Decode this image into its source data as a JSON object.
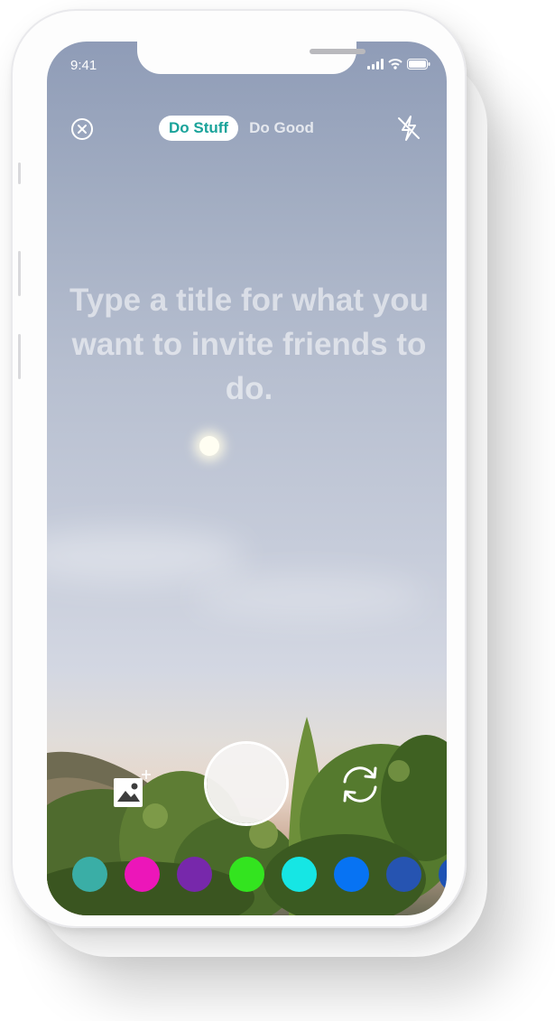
{
  "status_bar": {
    "time": "9:41"
  },
  "header": {
    "close_icon": "close-circle-icon",
    "tabs": [
      {
        "label": "Do Stuff",
        "selected": true
      },
      {
        "label": "Do Good",
        "selected": false
      }
    ],
    "flash_icon": "flash-off-icon"
  },
  "prompt": {
    "text": "Type a title for what you want to invite friends to do."
  },
  "controls": {
    "gallery_icon": "add-photo-icon",
    "shutter": "shutter-button",
    "flip_icon": "camera-flip-icon"
  },
  "colors": [
    "#3aaea6",
    "#ec16b9",
    "#7728ab",
    "#33e41f",
    "#16e6e4",
    "#0773f3",
    "#2654b1",
    "#1d52b4"
  ],
  "accent": "#1aa39a"
}
